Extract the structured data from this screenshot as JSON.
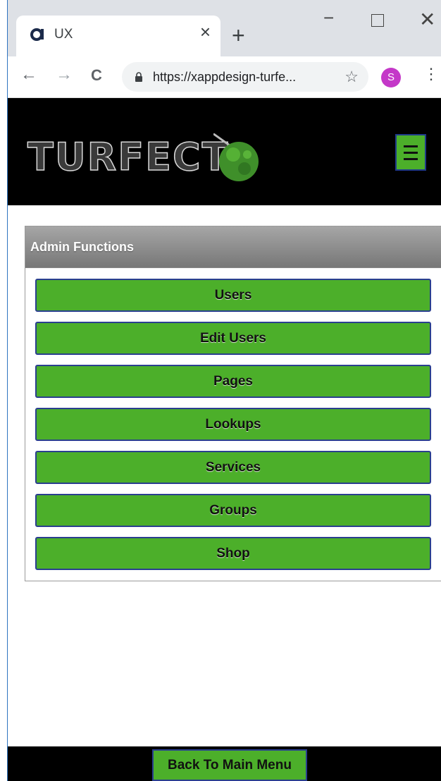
{
  "browser": {
    "tab_title": "UX",
    "tab_close": "×",
    "new_tab": "+",
    "url": "https://xappdesign-turfe...",
    "profile_initial": "S",
    "back": "←",
    "forward": "→",
    "reload": "C",
    "star": "☆",
    "menu": "⋮",
    "minimize": "−",
    "close": "✕"
  },
  "header": {
    "logo_text": "TURFECT",
    "menu_button_color": "#4caf2a"
  },
  "panel": {
    "title": "Admin Functions",
    "buttons": [
      {
        "label": "Users"
      },
      {
        "label": "Edit Users"
      },
      {
        "label": "Pages"
      },
      {
        "label": "Lookups"
      },
      {
        "label": "Services"
      },
      {
        "label": "Groups"
      },
      {
        "label": "Shop"
      }
    ]
  },
  "footer": {
    "back_label": "Back To Main Menu"
  },
  "colors": {
    "accent_green": "#4caf2a",
    "button_border": "#2a3f8f",
    "header_bg": "#000000"
  }
}
